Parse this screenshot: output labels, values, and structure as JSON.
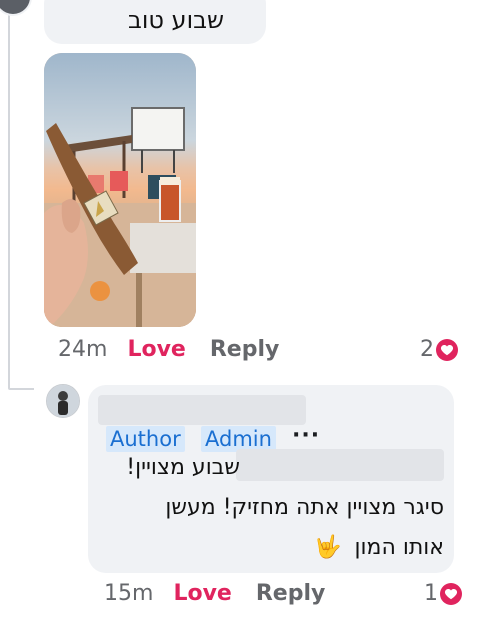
{
  "comment1": {
    "text": "שבוע טוב",
    "meta": {
      "time": "24m",
      "love_label": "Love",
      "reply_label": "Reply",
      "reaction_count": "2"
    }
  },
  "comment2": {
    "badges": {
      "author": "Author",
      "admin": "Admin",
      "more": "···"
    },
    "line1": "שבוע מצויין!",
    "line2": "סיגר מצויין אתה מחזיק! מעשן",
    "line3": "אותו המון",
    "emoji": "🤟",
    "meta": {
      "time": "15m",
      "love_label": "Love",
      "reply_label": "Reply",
      "reaction_count": "1"
    }
  },
  "colors": {
    "love": "#e0245e",
    "bubble": "#f0f2f5",
    "tag_bg": "#d6e8fb",
    "tag_text": "#1a6fd1",
    "meta_text": "#65676b"
  },
  "icons": {
    "reaction": "heart-icon"
  }
}
